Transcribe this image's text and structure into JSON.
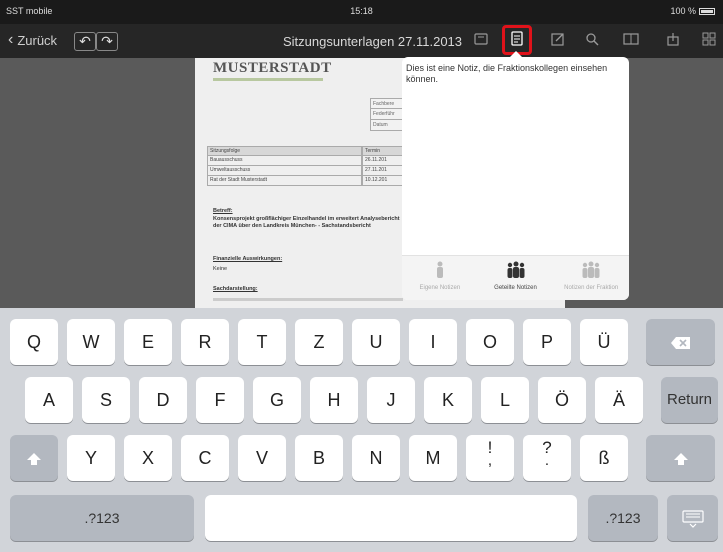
{
  "status_bar": {
    "carrier": "SST mobile",
    "time": "15:18",
    "battery": "100 %"
  },
  "nav": {
    "back_label": "Zurück",
    "undo_icon": "undo-icon",
    "redo_icon": "redo-icon",
    "title": "Sitzungsunterlagen 27.11.2013",
    "icons": [
      "info-icon",
      "notes-icon",
      "edit-icon",
      "search-icon",
      "book-icon",
      "share-icon",
      "grid-icon"
    ],
    "active_icon": "notes-icon",
    "highlight_color": "#e0121a"
  },
  "document": {
    "logo": "MUSTERSTADT",
    "side_table": [
      "Fachbere",
      "Federführ",
      "Datum"
    ],
    "sessions": [
      [
        "Sitzungsfolge",
        "Termin"
      ],
      [
        "Bauausschuss",
        "26.11.201"
      ],
      [
        "Umweltausschuss",
        "27.11.201"
      ],
      [
        "Rat der Stadt Musterstadt",
        "10.12.201"
      ]
    ],
    "betreff_heading": "Betreff:",
    "betreff_text": "Konsensprojekt großflächiger Einzelhandel im erweitert Analysebericht der CIMA über den Landkreis München- - Sachstandsbericht",
    "finance_heading": "Finanzielle Auswirkungen:",
    "finance_text": "Keine",
    "facts_heading": "Sachdarstellung:"
  },
  "note": {
    "text": "Dies ist eine Notiz, die Fraktionskollegen einsehen können.",
    "tabs": [
      {
        "label": "Eigene Notizen",
        "icon": "person-icon",
        "active": false
      },
      {
        "label": "Geteilte Notizen",
        "icon": "group-icon",
        "active": true
      },
      {
        "label": "Notizen der Fraktion",
        "icon": "faction-icon",
        "active": false
      }
    ]
  },
  "keyboard": {
    "row1": [
      "Q",
      "W",
      "E",
      "R",
      "T",
      "Z",
      "U",
      "I",
      "O",
      "P",
      "Ü"
    ],
    "row2": [
      "A",
      "S",
      "D",
      "F",
      "G",
      "H",
      "J",
      "K",
      "L",
      "Ö",
      "Ä"
    ],
    "row3": [
      "Y",
      "X",
      "C",
      "V",
      "B",
      "N",
      "M"
    ],
    "row3_sym": [
      [
        "!",
        ","
      ],
      [
        "?",
        "."
      ]
    ],
    "row3_last": "ß",
    "return_label": "Return",
    "numbers_label": ".?123",
    "backspace_icon": "backspace-icon",
    "shift_icon": "shift-icon",
    "hide_icon": "keyboard-hide-icon"
  }
}
